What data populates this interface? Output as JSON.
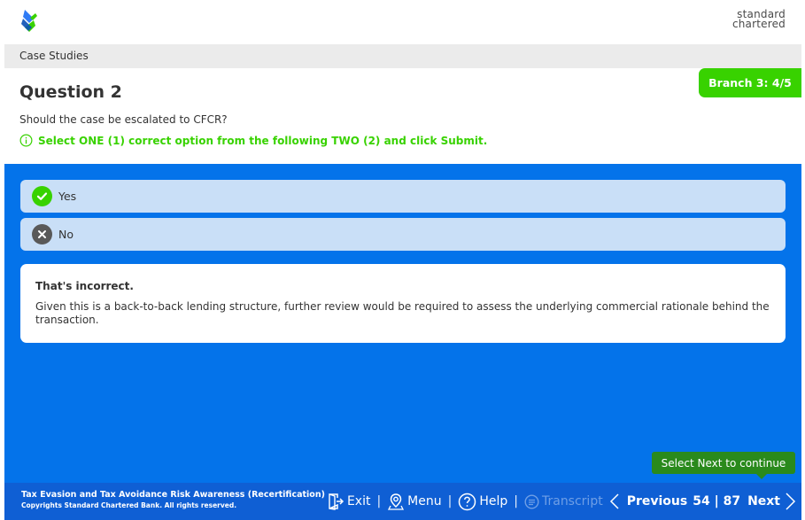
{
  "header": {
    "brand_line1": "standard",
    "brand_line2": "chartered",
    "breadcrumb": "Case Studies"
  },
  "badge": "Branch 3: 4/5",
  "question": {
    "title": "Question 2",
    "text": "Should the case be escalated to CFCR?",
    "instruction": "Select ONE (1) correct option from the following TWO (2) and click Submit."
  },
  "options": [
    {
      "label": "Yes",
      "icon": "check-icon",
      "color": "#38d200"
    },
    {
      "label": "No",
      "icon": "cross-icon",
      "color": "#595959"
    }
  ],
  "feedback": {
    "title": "That's incorrect.",
    "body": "Given this is a back-to-back lending structure, further review would be required to assess the underlying commercial rationale behind the transaction."
  },
  "tooltip": "Select Next to continue",
  "footer": {
    "course_title": "Tax Evasion and Tax Avoidance Risk Awareness (Recertification)",
    "copyright": "Copyrights Standard Chartered Bank. All rights reserved.",
    "exit_label": "Exit",
    "menu_label": "Menu",
    "help_label": "Help",
    "transcript_label": "Transcript",
    "previous_label": "Previous",
    "page_current": "54",
    "page_total": "87",
    "next_label": "Next"
  },
  "colors": {
    "accent_green": "#38d200",
    "content_blue": "#0473ea",
    "footer_blue": "#0f5fd4"
  }
}
